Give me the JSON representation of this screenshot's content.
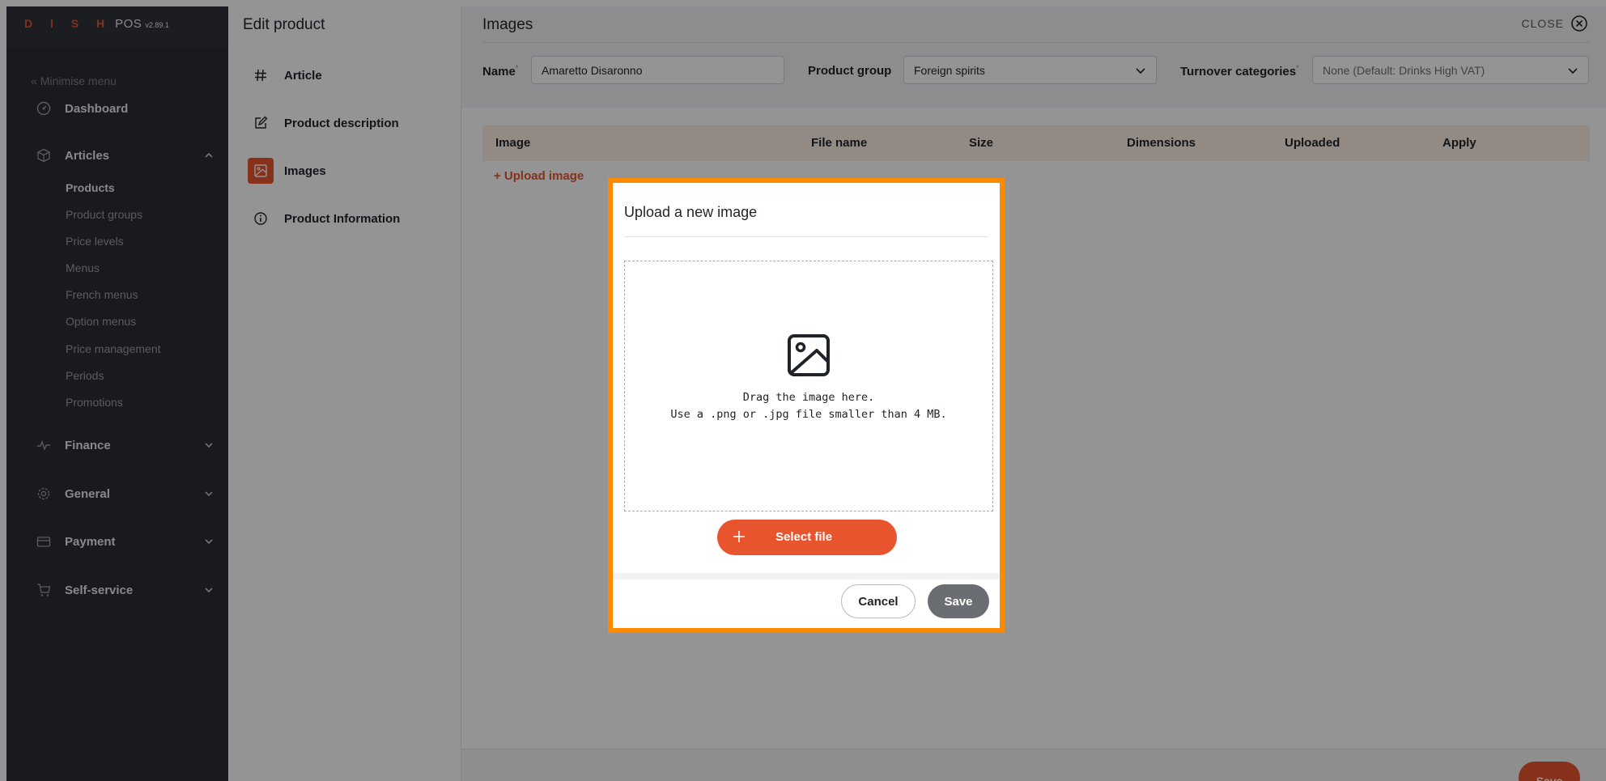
{
  "brand": {
    "name": "D I S H",
    "product": "POS",
    "version": "v2.89.1"
  },
  "sidebar": {
    "minimise_label": "Minimise menu",
    "items": [
      {
        "label": "Dashboard",
        "icon": "dashboard-icon"
      },
      {
        "label": "Articles",
        "icon": "box-icon",
        "expanded": true,
        "children": [
          "Products",
          "Product groups",
          "Price levels",
          "Menus",
          "French menus",
          "Option menus",
          "Price management",
          "Periods",
          "Promotions"
        ],
        "active_child": "Products"
      },
      {
        "label": "Finance",
        "icon": "pulse-icon",
        "expanded": false
      },
      {
        "label": "General",
        "icon": "gear-icon",
        "expanded": false
      },
      {
        "label": "Payment",
        "icon": "card-icon",
        "expanded": false
      },
      {
        "label": "Self-service",
        "icon": "cart-icon",
        "expanded": false
      }
    ]
  },
  "edit_product": {
    "title": "Edit product",
    "items": [
      {
        "label": "Article",
        "icon": "hash-icon"
      },
      {
        "label": "Product description",
        "icon": "edit-icon"
      },
      {
        "label": "Images",
        "icon": "image-icon",
        "active": true
      },
      {
        "label": "Product Information",
        "icon": "info-icon"
      }
    ]
  },
  "images_panel": {
    "title": "Images",
    "close_label": "CLOSE",
    "name_label": "Name",
    "name_value": "Amaretto Disaronno",
    "product_group_label": "Product group",
    "product_group_value": "Foreign spirits",
    "turnover_label": "Turnover categories",
    "turnover_value": "None (Default: Drinks High VAT)",
    "table_headers": [
      "Image",
      "File name",
      "Size",
      "Dimensions",
      "Uploaded",
      "Apply"
    ],
    "upload_link": "+ Upload image",
    "save_label": "Save"
  },
  "modal": {
    "title": "Upload a new image",
    "drop_line1": "Drag the image here.",
    "drop_line2": "Use a .png or .jpg file smaller than 4 MB.",
    "select_file_label": "Select file",
    "cancel_label": "Cancel",
    "save_label": "Save"
  },
  "colors": {
    "accent": "#e8542d",
    "highlight_border": "#ff8a00",
    "sidebar_bg": "#2a2d33"
  }
}
